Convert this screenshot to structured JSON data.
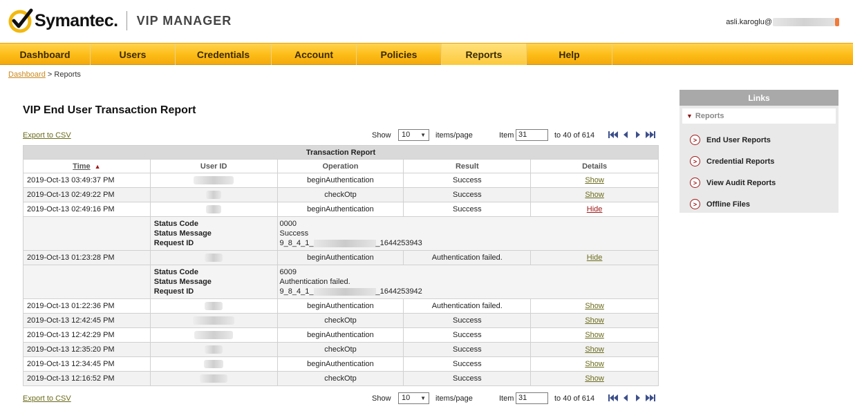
{
  "header": {
    "brand": "Symantec.",
    "product": "VIP MANAGER",
    "user_prefix": "asli.karoglu@"
  },
  "nav": {
    "items": [
      {
        "label": "Dashboard"
      },
      {
        "label": "Users"
      },
      {
        "label": "Credentials"
      },
      {
        "label": "Account"
      },
      {
        "label": "Policies"
      },
      {
        "label": "Reports",
        "active": true
      },
      {
        "label": "Help"
      }
    ]
  },
  "breadcrumb": {
    "root": "Dashboard",
    "sep": ">",
    "current": "Reports"
  },
  "page": {
    "title": "VIP End User Transaction Report"
  },
  "toolbar": {
    "export_label": "Export to CSV",
    "show_label": "Show",
    "per_page": "10",
    "items_per_page_label": "items/page",
    "item_label": "Item",
    "item_start": "31",
    "range_text": "to 40 of 614"
  },
  "table": {
    "caption": "Transaction Report",
    "columns": [
      "Time",
      "User ID",
      "Operation",
      "Result",
      "Details"
    ],
    "rows": [
      {
        "time": "2019-Oct-13 03:49:37 PM",
        "operation": "beginAuthentication",
        "result": "Success",
        "details": "Show"
      },
      {
        "time": "2019-Oct-13 02:49:22 PM",
        "operation": "checkOtp",
        "result": "Success",
        "details": "Show"
      },
      {
        "time": "2019-Oct-13 02:49:16 PM",
        "operation": "beginAuthentication",
        "result": "Success",
        "details": "Hide"
      },
      {
        "time": "2019-Oct-13 01:23:28 PM",
        "operation": "beginAuthentication",
        "result": "Authentication failed.",
        "details": "Hide"
      },
      {
        "time": "2019-Oct-13 01:22:36 PM",
        "operation": "beginAuthentication",
        "result": "Authentication failed.",
        "details": "Show"
      },
      {
        "time": "2019-Oct-13 12:42:45 PM",
        "operation": "checkOtp",
        "result": "Success",
        "details": "Show"
      },
      {
        "time": "2019-Oct-13 12:42:29 PM",
        "operation": "beginAuthentication",
        "result": "Success",
        "details": "Show"
      },
      {
        "time": "2019-Oct-13 12:35:20 PM",
        "operation": "checkOtp",
        "result": "Success",
        "details": "Show"
      },
      {
        "time": "2019-Oct-13 12:34:45 PM",
        "operation": "beginAuthentication",
        "result": "Success",
        "details": "Show"
      },
      {
        "time": "2019-Oct-13 12:16:52 PM",
        "operation": "checkOtp",
        "result": "Success",
        "details": "Show"
      }
    ],
    "detail_labels": {
      "status_code": "Status Code",
      "status_message": "Status Message",
      "request_id": "Request ID"
    },
    "details": [
      {
        "status_code": "0000",
        "status_message": "Success",
        "request_prefix": "9_8_4_1_",
        "request_suffix": "_1644253943"
      },
      {
        "status_code": "6009",
        "status_message": "Authentication failed.",
        "request_prefix": "9_8_4_1_",
        "request_suffix": "_1644253942"
      }
    ]
  },
  "links": {
    "title": "Links",
    "section": "Reports",
    "items": [
      "End User Reports",
      "Credential Reports",
      "View Audit Reports",
      "Offline Files"
    ]
  },
  "colors": {
    "nav_gold": "#fdbc17",
    "hide_link": "#a01818",
    "show_link": "#6a6a1a",
    "breadcrumb_link": "#c9891e"
  }
}
